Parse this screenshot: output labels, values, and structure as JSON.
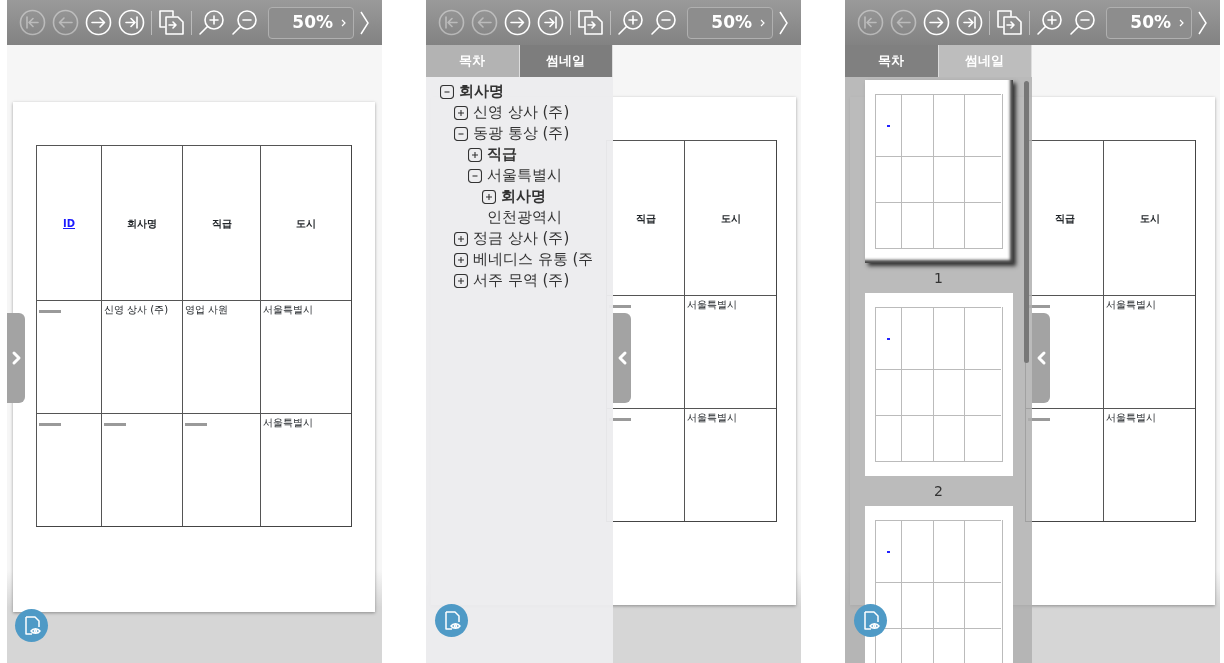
{
  "panels": [
    {
      "kind": "page",
      "toolbar": {
        "buttons": [
          {
            "kind": "first",
            "disabled": true
          },
          {
            "kind": "prev",
            "disabled": true
          },
          {
            "kind": "next",
            "disabled": false
          },
          {
            "kind": "last",
            "disabled": false
          },
          {
            "kind": "separator"
          },
          {
            "kind": "export",
            "disabled": false
          },
          {
            "kind": "separator"
          },
          {
            "kind": "zoom-in",
            "disabled": false
          },
          {
            "kind": "zoom-out",
            "disabled": false
          }
        ],
        "zoom": "50%"
      },
      "handle": {
        "kind": "chevron-right"
      },
      "page": {
        "columns": [
          {
            "label": "ID",
            "link": true
          },
          {
            "label": "회사명",
            "link": false
          },
          {
            "label": "직급",
            "link": false
          },
          {
            "label": "도시",
            "link": false
          }
        ],
        "rows": [
          [
            null,
            "신영 상사 (주)",
            "영업 사원",
            "서울특별시"
          ],
          [
            null,
            null,
            null,
            "서울특별시"
          ]
        ]
      }
    },
    {
      "kind": "toc",
      "toolbar": {
        "buttons": [
          {
            "kind": "first",
            "disabled": true
          },
          {
            "kind": "prev",
            "disabled": true
          },
          {
            "kind": "next",
            "disabled": false
          },
          {
            "kind": "last",
            "disabled": false
          },
          {
            "kind": "separator"
          },
          {
            "kind": "export",
            "disabled": false
          },
          {
            "kind": "separator"
          },
          {
            "kind": "zoom-in",
            "disabled": false
          },
          {
            "kind": "zoom-out",
            "disabled": false
          }
        ],
        "zoom": "50%"
      },
      "handle": {
        "kind": "chevron-left"
      },
      "page": {
        "columns": [
          {
            "label": "직급",
            "link": false
          },
          {
            "label": "도시",
            "link": false
          }
        ],
        "rows": [
          [
            null,
            "서울특별시"
          ],
          [
            null,
            "서울특별시"
          ]
        ]
      },
      "tabs": [
        {
          "label": "목차",
          "selected": true
        },
        {
          "label": "썸네일",
          "selected": false
        }
      ],
      "tree": [
        {
          "label": "회사명",
          "bold": true,
          "expanded": true,
          "children": [
            {
              "label": "신영 상사 (주)",
              "bold": false,
              "expanded": false
            },
            {
              "label": "동광 통상 (주)",
              "bold": false,
              "expanded": true,
              "children": [
                {
                  "label": "직급",
                  "bold": true,
                  "expanded": false
                },
                {
                  "label": "서울특별시",
                  "bold": false,
                  "expanded": true,
                  "children": [
                    {
                      "label": "회사명",
                      "bold": true,
                      "expanded": false
                    }
                  ]
                },
                {
                  "label": "인천광역시",
                  "bold": false
                }
              ]
            },
            {
              "label": "정금 상사 (주)",
              "bold": false,
              "expanded": false
            },
            {
              "label": "베네디스 유통 (주",
              "bold": false,
              "expanded": false
            },
            {
              "label": "서주 무역 (주)",
              "bold": false,
              "expanded": false
            }
          ]
        }
      ]
    },
    {
      "kind": "thumbnails",
      "toolbar": {
        "buttons": [
          {
            "kind": "first",
            "disabled": true
          },
          {
            "kind": "prev",
            "disabled": true
          },
          {
            "kind": "next",
            "disabled": false
          },
          {
            "kind": "last",
            "disabled": false
          },
          {
            "kind": "separator"
          },
          {
            "kind": "export",
            "disabled": false
          },
          {
            "kind": "separator"
          },
          {
            "kind": "zoom-in",
            "disabled": false
          },
          {
            "kind": "zoom-out",
            "disabled": false
          }
        ],
        "zoom": "50%"
      },
      "handle": {
        "kind": "chevron-left"
      },
      "page": {
        "columns": [
          {
            "label": "직급",
            "link": false
          },
          {
            "label": "도시",
            "link": false
          }
        ],
        "rows": [
          [
            null,
            "서울특별시"
          ],
          [
            null,
            "서울특별시"
          ]
        ]
      },
      "tabs": [
        {
          "label": "목차",
          "selected": false
        },
        {
          "label": "썸네일",
          "selected": true
        }
      ],
      "thumbnails": [
        {
          "label": "1",
          "selected": true
        },
        {
          "label": "2",
          "selected": false
        },
        {
          "selected": false
        }
      ]
    }
  ]
}
